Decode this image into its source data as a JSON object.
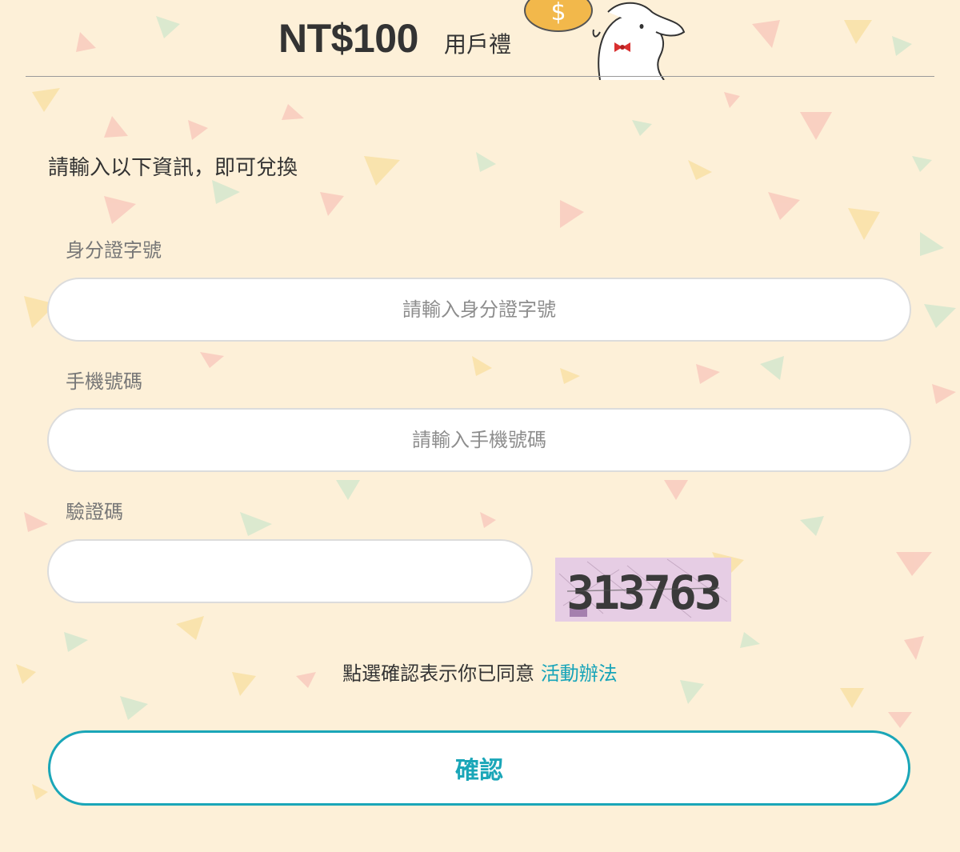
{
  "header": {
    "amount": "NT$100",
    "suffix": "用戶禮",
    "coin_symbol": "$"
  },
  "form": {
    "intro": "請輸入以下資訊，即可兌換",
    "id_label": "身分證字號",
    "id_placeholder": "請輸入身分證字號",
    "phone_label": "手機號碼",
    "phone_placeholder": "請輸入手機號碼",
    "captcha_label": "驗證碼",
    "captcha_value": "",
    "captcha_code": "313763"
  },
  "agreement": {
    "text": "點選確認表示你已同意 ",
    "link": "活動辦法"
  },
  "confirm_button": "確認",
  "colors": {
    "background": "#fdf0d8",
    "accent": "#1aa6b8",
    "text": "#333333",
    "label": "#777777"
  }
}
